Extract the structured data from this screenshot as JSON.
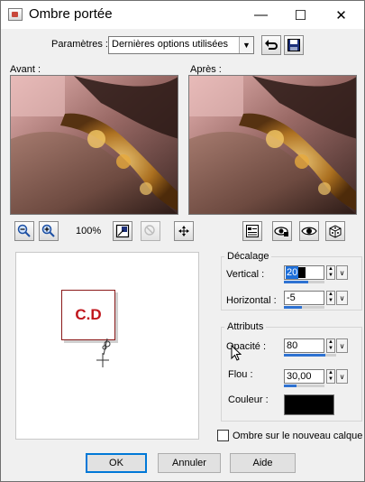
{
  "window": {
    "title": "Ombre portée",
    "minimize_glyph": "—",
    "maximize_glyph": "☐",
    "close_glyph": "✕"
  },
  "params": {
    "label": "Paramètres :",
    "preset_value": "Dernières options utilisées",
    "reset_icon": "reset-arrow-icon",
    "save_icon": "floppy-disk-icon"
  },
  "preview": {
    "before_label": "Avant :",
    "after_label": "Après :",
    "zoom_level": "100%"
  },
  "canvas": {
    "logo_text": "C.D"
  },
  "offset": {
    "title": "Décalage",
    "vertical_label": "Vertical :",
    "vertical_value": "20",
    "vertical_level": 0.6,
    "horizontal_label": "Horizontal :",
    "horizontal_value": "-5",
    "horizontal_level": 0.45
  },
  "attributes": {
    "title": "Attributs",
    "opacity_label": "Opacité :",
    "opacity_value": "80",
    "opacity_level": 0.8,
    "blur_label": "Flou :",
    "blur_value": "30,00",
    "blur_level": 0.3,
    "color_label": "Couleur :",
    "color_value": "#000000"
  },
  "options": {
    "new_layer_label": "Ombre sur le nouveau calque",
    "new_layer_checked": false
  },
  "buttons": {
    "ok": "OK",
    "cancel": "Annuler",
    "help": "Aide"
  },
  "colors": {
    "accent": "#2e72d2",
    "logo_red": "#c0161c"
  }
}
